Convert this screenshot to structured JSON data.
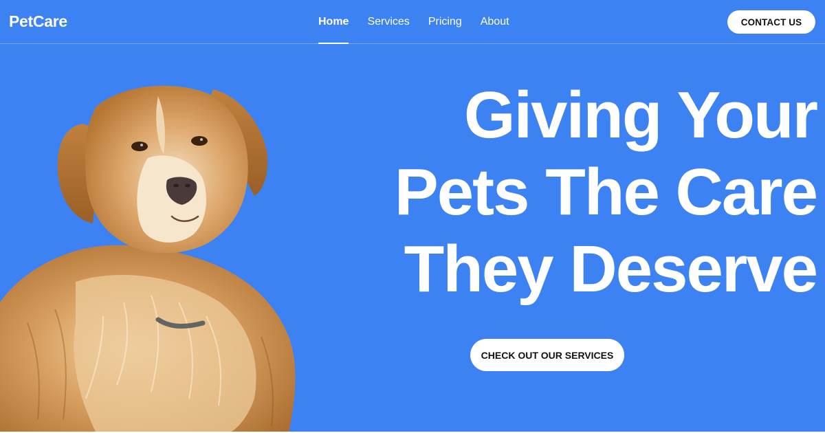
{
  "brand": {
    "name": "PetCare"
  },
  "nav": {
    "links": [
      {
        "label": "Home",
        "active": true
      },
      {
        "label": "Services",
        "active": false
      },
      {
        "label": "Pricing",
        "active": false
      },
      {
        "label": "About",
        "active": false
      }
    ],
    "contact_label": "CONTACT US"
  },
  "hero": {
    "headline_lines": [
      "Giving Your",
      "Pets The Care",
      "They Deserve"
    ],
    "cta_label": "CHECK OUT OUR SERVICES",
    "image": "golden-retriever-dog"
  },
  "colors": {
    "background": "#3d82f3",
    "text": "#ffffff",
    "button_bg": "#ffffff",
    "button_text": "#111111"
  }
}
